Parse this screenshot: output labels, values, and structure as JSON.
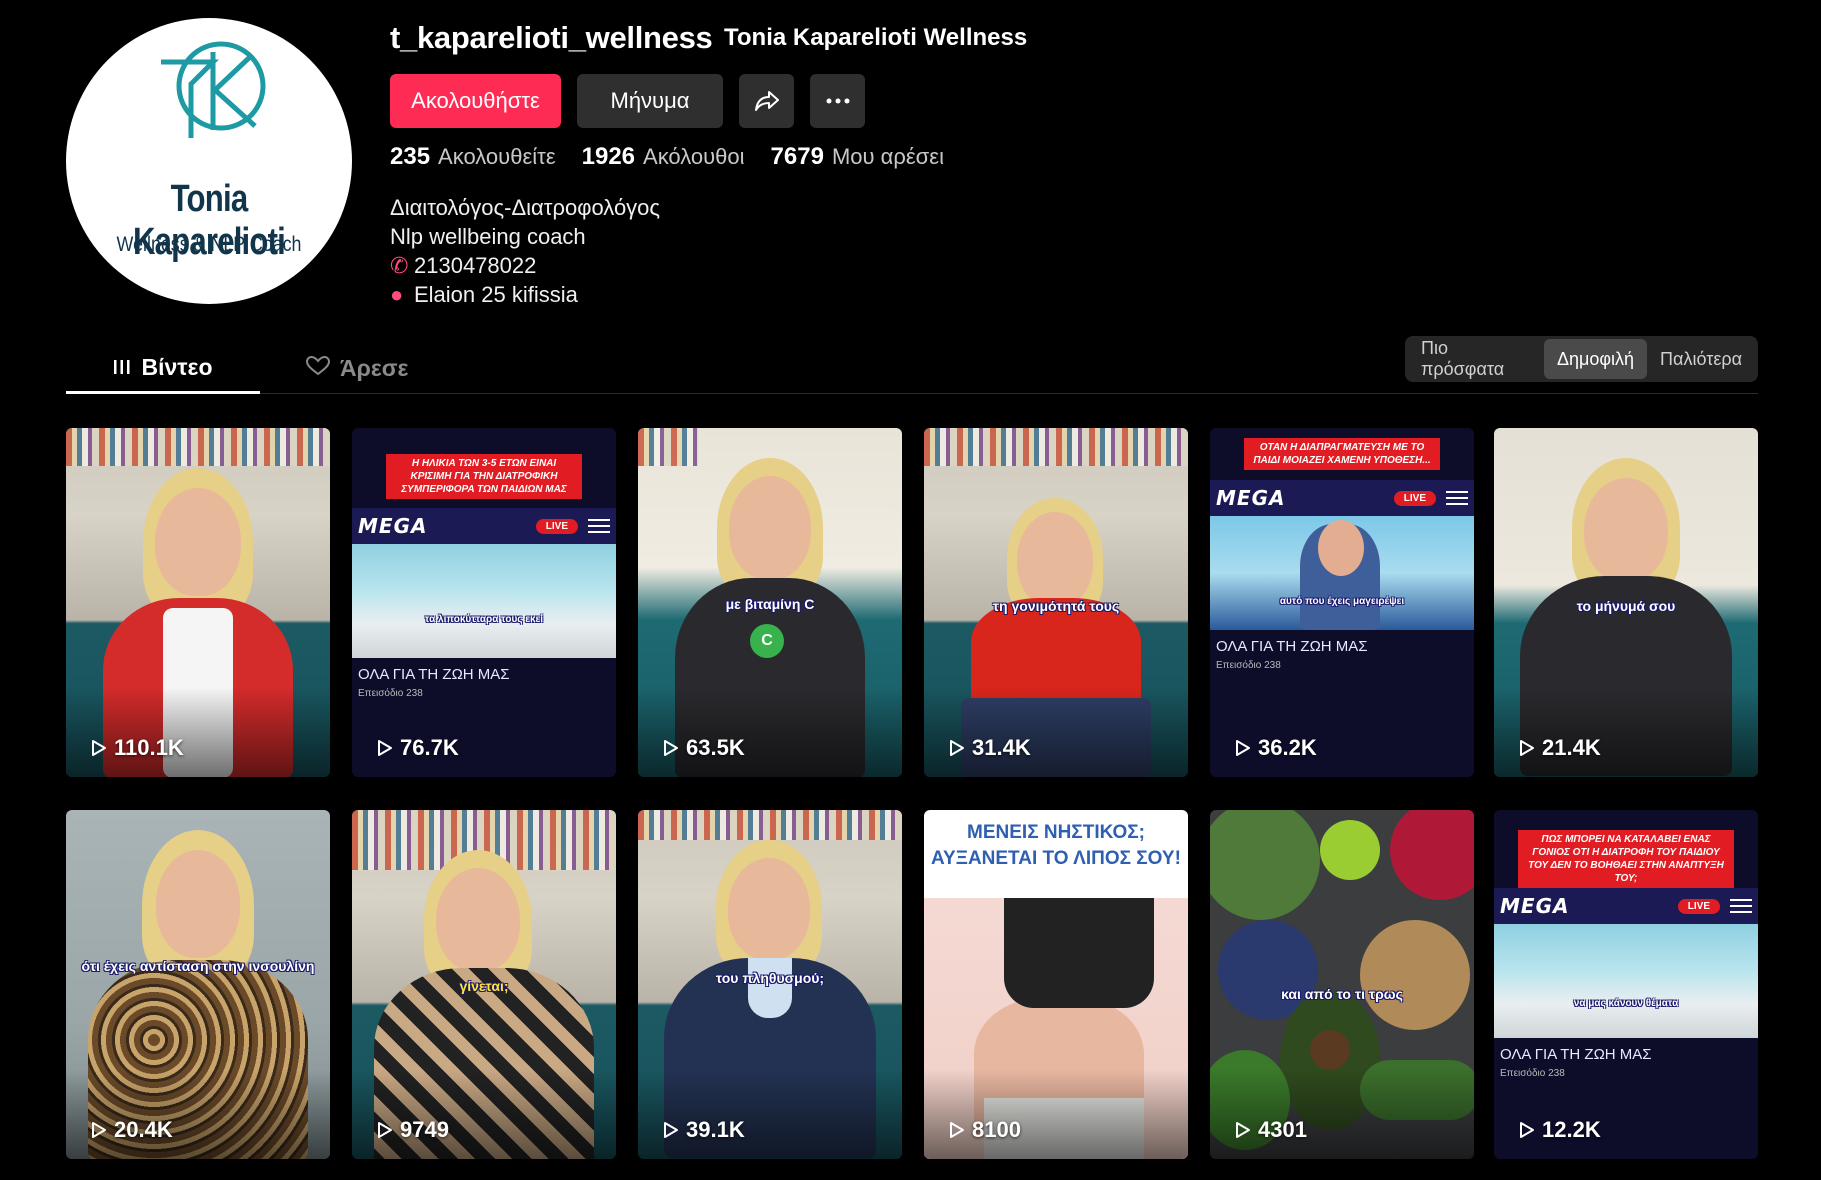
{
  "profile": {
    "avatar": {
      "logo_name": "Tonia Kaparelioti",
      "logo_tagline": "Wellness & NLP Coach"
    },
    "username": "t_kaparelioti_wellness",
    "display_name": "Tonia Kaparelioti Wellness",
    "follow_label": "Ακολουθήστε",
    "message_label": "Μήνυμα",
    "share_icon": "share-icon",
    "more_icon": "more-icon",
    "stats": [
      {
        "value": "235",
        "label": "Ακολουθείτε"
      },
      {
        "value": "1926",
        "label": "Ακόλουθοι"
      },
      {
        "value": "7679",
        "label": "Μου αρέσει"
      }
    ],
    "bio": {
      "line1": "Διαιτολόγος-Διατροφολόγος",
      "line2": "Nlp wellbeing coach",
      "phone": "2130478022",
      "address": "Elaion 25 kifissia"
    }
  },
  "tabs": [
    {
      "label": "Βίντεο",
      "active": true
    },
    {
      "label": "Άρεσε",
      "active": false
    }
  ],
  "sort": {
    "options": [
      "Πιο πρόσφατα",
      "Δημοφιλή",
      "Παλιότερα"
    ],
    "active": "Δημοφιλή"
  },
  "colors": {
    "accent": "#fe2c55",
    "background": "#000000",
    "button": "#2f2f2f",
    "mega_red": "#e11c22",
    "mega_blue": "#1b1a55"
  },
  "videos": [
    {
      "views": "110.1K"
    },
    {
      "views": "76.7K",
      "banner": "Η ΗΛΙΚΙΑ ΤΩΝ 3-5 ΕΤΩΝ ΕΙΝΑΙ ΚΡΙΣΙΜΗ ΓΙΑ ΤΗΝ ΔΙΑΤΡΟΦΙΚΗ ΣΥΜΠΕΡΙΦΟΡΑ ΤΩΝ ΠΑΙΔΙΩΝ ΜΑΣ",
      "brand": "MEGA",
      "live": "LIVE",
      "show": "ΟΛΑ ΓΙΑ ΤΗ ΖΩΗ ΜΑΣ",
      "episode": "Επεισόδιο 238",
      "caption": "τα λιποκύτταρα τους εκεί"
    },
    {
      "views": "63.5K",
      "caption": "με βιταμίνη C"
    },
    {
      "views": "31.4K",
      "caption": "τη γονιμότητά τους"
    },
    {
      "views": "36.2K",
      "banner": "ΟΤΑΝ Η ΔΙΑΠΡΑΓΜΑΤΕΥΣΗ ΜΕ ΤΟ ΠΑΙΔΙ ΜΟΙΑΖΕΙ ΧΑΜΕΝΗ ΥΠΟΘΕΣΗ...",
      "brand": "MEGA",
      "live": "LIVE",
      "show": "ΟΛΑ ΓΙΑ ΤΗ ΖΩΗ ΜΑΣ",
      "episode": "Επεισόδιο 238",
      "caption": "αυτό που έχεις μαγειρέψει"
    },
    {
      "views": "21.4K",
      "caption": "το μήνυμά σου"
    },
    {
      "views": "20.4K",
      "caption": "ότι έχεις αντίσταση στην ινσουλίνη"
    },
    {
      "views": "9749",
      "caption": "γίνεται;"
    },
    {
      "views": "39.1K",
      "caption": "του πληθυσμού;"
    },
    {
      "views": "8100",
      "title": "ΜΕΝΕΙΣ ΝΗΣΤΙΚΟΣ; ΑΥΞΑΝΕΤΑΙ ΤΟ ΛΙΠΟΣ ΣΟΥ!"
    },
    {
      "views": "4301",
      "caption": "και από το τι τρως"
    },
    {
      "views": "12.2K",
      "banner": "ΠΩΣ ΜΠΟΡΕΙ ΝΑ ΚΑΤΑΛΑΒΕΙ ΕΝΑΣ ΓΟΝΙΟΣ ΟΤΙ Η ΔΙΑΤΡΟΦΗ ΤΟΥ ΠΑΙΔΙΟΥ ΤΟΥ ΔΕΝ ΤΟ ΒΟΗΘΑΕΙ ΣΤΗΝ ΑΝΑΠΤΥΞΗ ΤΟΥ;",
      "brand": "MEGA",
      "live": "LIVE",
      "show": "ΟΛΑ ΓΙΑ ΤΗ ΖΩΗ ΜΑΣ",
      "episode": "Επεισόδιο 238",
      "caption": "να μας κάνουν θέματα"
    }
  ]
}
